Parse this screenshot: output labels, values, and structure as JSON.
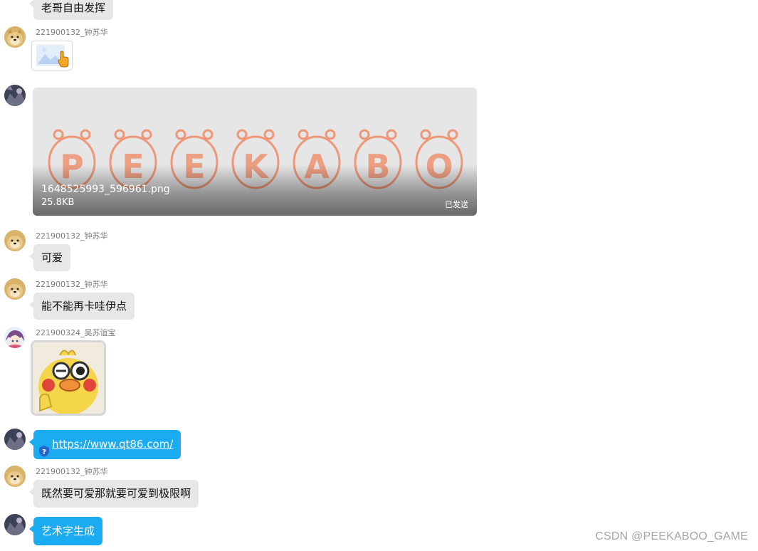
{
  "messages": {
    "top_bubble": "老哥自由发挥",
    "m1": {
      "sender": "221900132_钟苏华"
    },
    "file": {
      "name": "1648525993_596961.png",
      "size": "25.8KB",
      "status": "已发送"
    },
    "m3": {
      "sender": "221900132_钟苏华",
      "text": "可爱"
    },
    "m4": {
      "sender": "221900132_钟苏华",
      "text": "能不能再卡哇伊点"
    },
    "m5": {
      "sender": "221900324_吴苏谊宝"
    },
    "link": {
      "url": "https://www.qt86.com/"
    },
    "m7": {
      "sender": "221900132_钟苏华",
      "text": "既然要可爱那就要可爱到极限啊"
    },
    "m8": {
      "text": "艺术字生成"
    }
  },
  "image_art_text": "PEEKABOO",
  "watermark": "CSDN @PEEKABOO_GAME",
  "colors": {
    "bubble_gray": "#e7e7e7",
    "bubble_blue": "#1aabf0",
    "hamster_orange": "#ee9878"
  }
}
